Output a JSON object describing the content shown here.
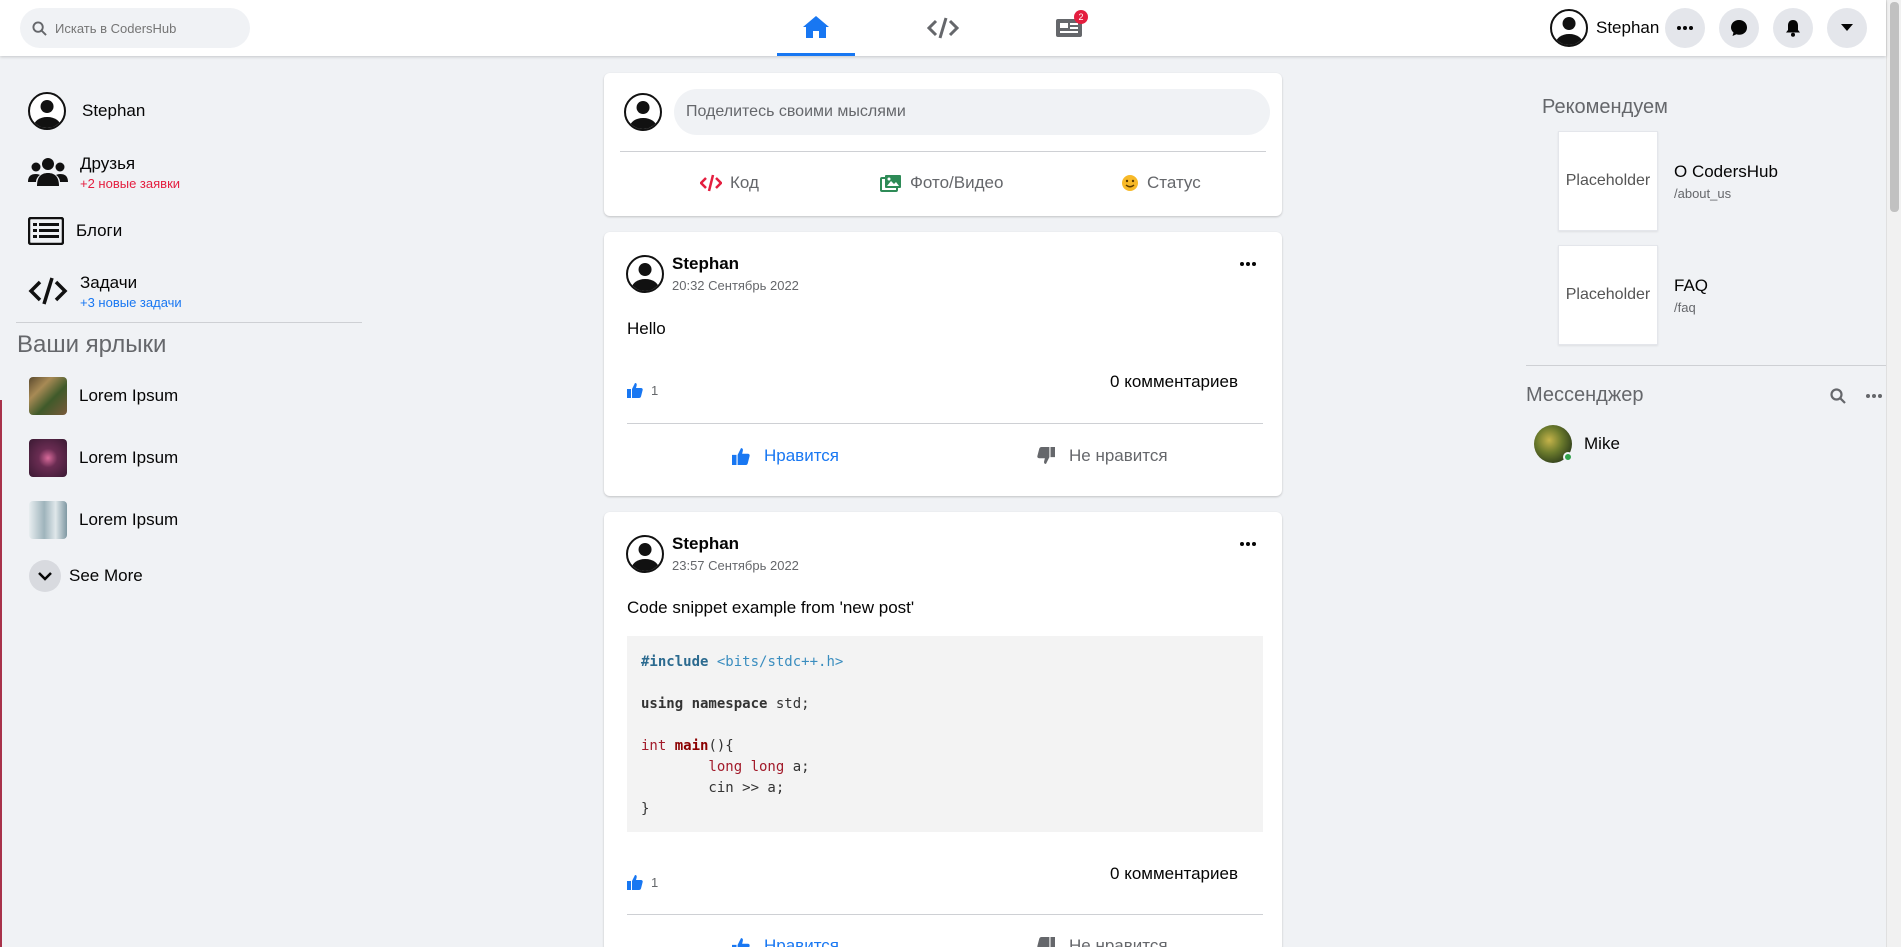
{
  "topbar": {
    "search_placeholder": "Искать в CodersHub",
    "tabs": [
      {
        "name": "home",
        "icon": "home-icon",
        "active": true
      },
      {
        "name": "code",
        "icon": "code-icon",
        "active": false
      },
      {
        "name": "blogs",
        "icon": "newspaper-icon",
        "active": false,
        "badge": "2"
      }
    ],
    "user_name": "Stephan",
    "accent": "#1877f2"
  },
  "left": {
    "profile_name": "Stephan",
    "friends_label": "Друзья",
    "friends_sub": "+2 новые заявки",
    "blogs_label": "Блоги",
    "tasks_label": "Задачи",
    "tasks_sub": "+3 новые задачи",
    "shortcuts_title": "Ваши ярлыки",
    "shortcuts": [
      {
        "label": "Lorem Ipsum"
      },
      {
        "label": "Lorem Ipsum"
      },
      {
        "label": "Lorem Ipsum"
      }
    ],
    "see_more": "See More"
  },
  "composer": {
    "placeholder": "Поделитесь своими мыслями",
    "code": "Код",
    "photo": "Фото/Видео",
    "status": "Статус"
  },
  "posts": [
    {
      "author": "Stephan",
      "time": "20:32 Сентябрь 2022",
      "text": "Hello",
      "likes": "1",
      "comments": "0 комментариев",
      "like_label": "Нравится",
      "dislike_label": "Не нравится"
    },
    {
      "author": "Stephan",
      "time": "23:57 Сентябрь 2022",
      "text": "Code snippet example from 'new post'",
      "code": {
        "l1a": "#include",
        "l1b": " <bits/stdc++.h>",
        "l3a": "using namespace",
        "l3b": " std;",
        "l5a": "int",
        "l5b": "main",
        "l5c": "(){",
        "l6a": "        long long",
        "l6b": " a;",
        "l7": "        cin >> a;",
        "l8": "}"
      },
      "likes": "1",
      "comments": "0 комментариев",
      "like_label": "Нравится",
      "dislike_label": "Не нравится"
    }
  ],
  "right": {
    "recommend_title": "Рекомендуем",
    "recommendations": [
      {
        "thumb": "Placeholder",
        "title": "O CodersHub",
        "path": "/about_us"
      },
      {
        "thumb": "Placeholder",
        "title": "FAQ",
        "path": "/faq"
      }
    ],
    "messenger_title": "Мессенджер",
    "contacts": [
      {
        "name": "Mike",
        "online": true
      }
    ]
  }
}
